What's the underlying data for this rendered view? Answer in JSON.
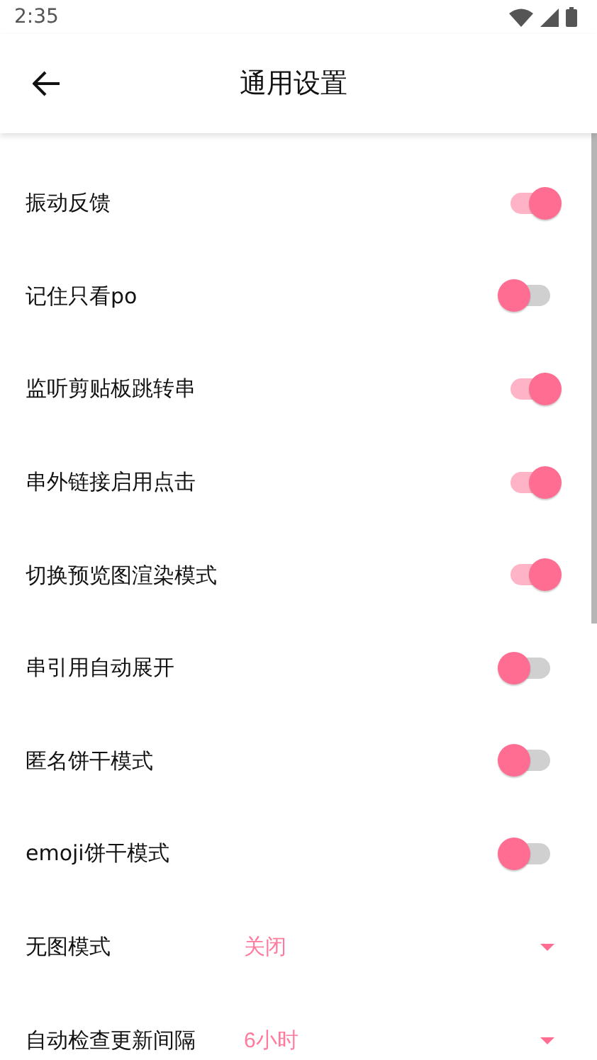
{
  "status_bar": {
    "time": "2:35"
  },
  "app_bar": {
    "title": "通用设置"
  },
  "settings": [
    {
      "kind": "switch",
      "label": "振动反馈",
      "on": true
    },
    {
      "kind": "switch",
      "label": "记住只看po",
      "on": false
    },
    {
      "kind": "switch",
      "label": "监听剪贴板跳转串",
      "on": true
    },
    {
      "kind": "switch",
      "label": "串外链接启用点击",
      "on": true
    },
    {
      "kind": "switch",
      "label": "切换预览图渲染模式",
      "on": true
    },
    {
      "kind": "switch",
      "label": "串引用自动展开",
      "on": false
    },
    {
      "kind": "switch",
      "label": "匿名饼干模式",
      "on": false
    },
    {
      "kind": "switch",
      "label": "emoji饼干模式",
      "on": false
    },
    {
      "kind": "select",
      "label": "无图模式",
      "value": "关闭"
    },
    {
      "kind": "select",
      "label": "自动检查更新间隔",
      "value": "6小时"
    }
  ]
}
